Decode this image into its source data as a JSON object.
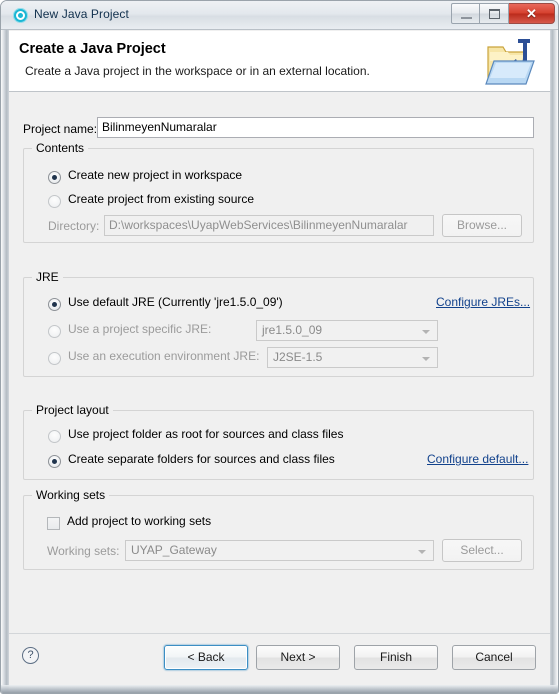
{
  "window": {
    "title": "New Java Project",
    "icon": "eclipse-circle-icon",
    "controls": {
      "minimize": "minimize-button",
      "maximize": "maximize-button",
      "close_glyph": "✕"
    }
  },
  "header": {
    "title": "Create a Java Project",
    "description": "Create a Java project in the workspace or in an external location.",
    "image": "java-project-folder-icon"
  },
  "project": {
    "name_label": "Project name:",
    "name_value": "BilinmeyenNumaralar",
    "name_placeholder": ""
  },
  "contents": {
    "group_title": "Contents",
    "option_new": "Create new project in workspace",
    "option_existing": "Create project from existing source",
    "option_selected": "new",
    "directory_label": "Directory:",
    "directory_value": "D:\\workspaces\\UyapWebServices\\BilinmeyenNumaralar",
    "browse_label": "Browse..."
  },
  "jre": {
    "group_title": "JRE",
    "option_default": "Use default JRE (Currently 'jre1.5.0_09')",
    "option_specific": "Use a project specific JRE:",
    "option_execenv": "Use an execution environment JRE:",
    "option_selected": "default",
    "specific_value": "jre1.5.0_09",
    "execenv_value": "J2SE-1.5",
    "configure_link": "Configure JREs..."
  },
  "layout": {
    "group_title": "Project layout",
    "option_root": "Use project folder as root for sources and class files",
    "option_separate": "Create separate folders for sources and class files",
    "option_selected": "separate",
    "configure_link": "Configure default..."
  },
  "working_sets": {
    "group_title": "Working sets",
    "checkbox_label": "Add project to working sets",
    "checked": false,
    "sets_label": "Working sets:",
    "sets_value": "UYAP_Gateway",
    "select_label": "Select..."
  },
  "footer": {
    "help": "?",
    "back": "< Back",
    "next": "Next >",
    "finish": "Finish",
    "cancel": "Cancel",
    "focused_button": "back"
  },
  "colors": {
    "link": "#12428c",
    "dialog_bg": "#f0f0f0",
    "header_bg": "#ffffff",
    "radio_dot": "#20344d",
    "close_button": "#d6412f",
    "focus_ring": "#3c8ec4"
  }
}
